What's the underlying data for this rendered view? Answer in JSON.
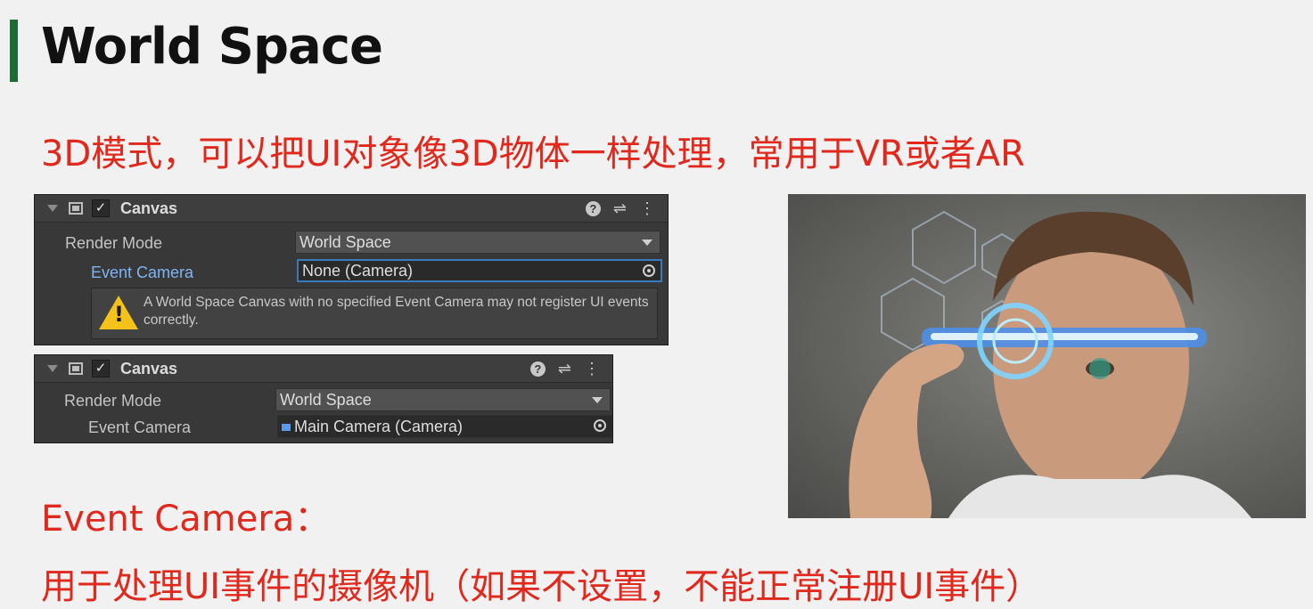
{
  "slide": {
    "title": "World Space",
    "subtitle": "3D模式，可以把UI对象像3D物体一样处理，常用于VR或者AR",
    "caption_heading": "Event Camera：",
    "caption_body": "用于处理UI事件的摄像机（如果不设置，不能正常注册UI事件）"
  },
  "inspector1": {
    "component_name": "Canvas",
    "check": "✓",
    "render_mode_label": "Render Mode",
    "render_mode_value": "World Space",
    "event_camera_label": "Event Camera",
    "event_camera_value": "None (Camera)",
    "warning_mark": "!",
    "warning_text": "A World Space Canvas with no specified Event Camera may not register UI events correctly."
  },
  "inspector2": {
    "component_name": "Canvas",
    "check": "✓",
    "render_mode_label": "Render Mode",
    "render_mode_value": "World Space",
    "event_camera_label": "Event Camera",
    "event_camera_value": "Main Camera (Camera)"
  },
  "header_icons": {
    "help": "?",
    "settings": "⇌",
    "more": "⋮"
  },
  "colors": {
    "accent_bar": "#1f6b34",
    "red_text": "#e0281c",
    "inspector_bg": "#383838",
    "highlight_label": "#7fb4f5",
    "warning_yellow": "#f4c21a"
  }
}
